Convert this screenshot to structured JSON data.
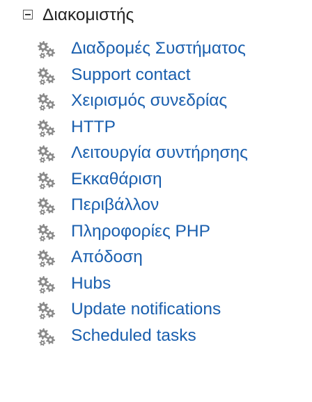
{
  "tree": {
    "root": {
      "label": "Διακομιστής",
      "expanded": true,
      "toggle_icon": "collapse-minus-icon"
    },
    "children_icon": "gears-icon",
    "children": [
      {
        "label": "Διαδρομές Συστήματος"
      },
      {
        "label": "Support contact"
      },
      {
        "label": "Χειρισμός συνεδρίας"
      },
      {
        "label": "HTTP"
      },
      {
        "label": "Λειτουργία συντήρησης"
      },
      {
        "label": "Εκκαθάριση"
      },
      {
        "label": "Περιβάλλον"
      },
      {
        "label": "Πληροφορίες PHP"
      },
      {
        "label": "Απόδοση"
      },
      {
        "label": "Hubs"
      },
      {
        "label": "Update notifications"
      },
      {
        "label": "Scheduled tasks"
      }
    ]
  },
  "colors": {
    "link": "#1a5fae",
    "root_text": "#222222",
    "icon_gray": "#8a8a8a"
  }
}
